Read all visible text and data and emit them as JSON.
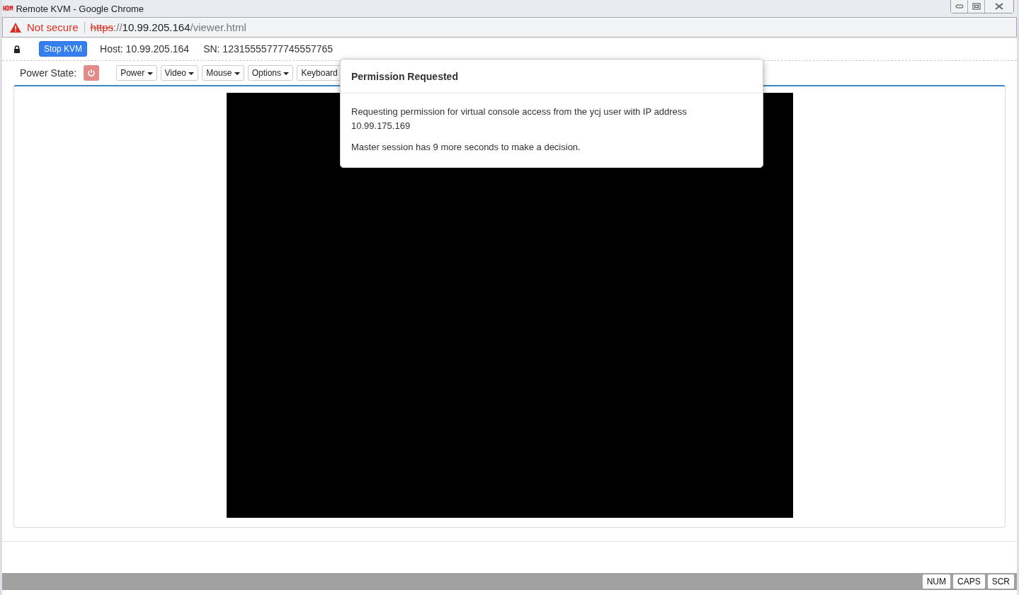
{
  "window": {
    "title": "Remote KVM - Google Chrome",
    "logo": "HDM"
  },
  "address_bar": {
    "security": "Not secure",
    "scheme": "https",
    "separator": "://",
    "host": "10.99.205.164",
    "path": "/viewer.html"
  },
  "header": {
    "stop_button": "Stop KVM",
    "host": "Host: 10.99.205.164",
    "sn": "SN: 12315555777745557765"
  },
  "toolbar": {
    "power_state_label": "Power State:",
    "menus": [
      "Power",
      "Video",
      "Mouse",
      "Options",
      "Keyboard"
    ]
  },
  "dialog": {
    "title": "Permission Requested",
    "paragraphs": [
      "Requesting permission for virtual console access from the ycj user with IP address 10.99.175.169",
      "Master session has 9 more seconds to make a decision."
    ]
  },
  "status_bar": {
    "indicators": [
      "NUM",
      "CAPS",
      "SCR"
    ]
  }
}
